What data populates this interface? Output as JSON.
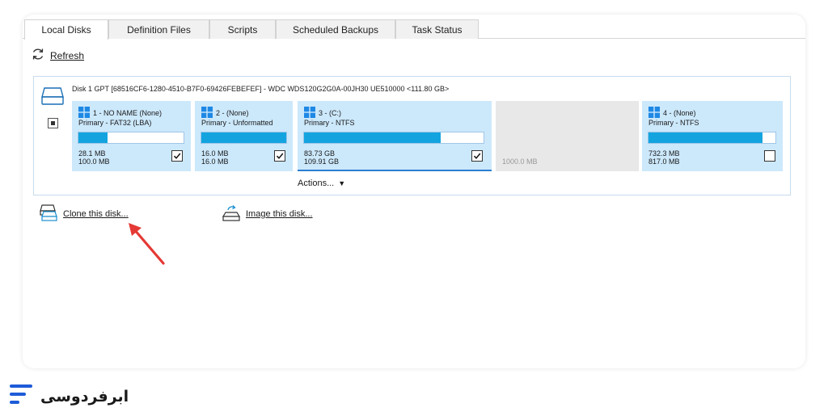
{
  "tabs": [
    {
      "label": "Local Disks"
    },
    {
      "label": "Definition Files"
    },
    {
      "label": "Scripts"
    },
    {
      "label": "Scheduled Backups"
    },
    {
      "label": "Task Status"
    }
  ],
  "toolbar": {
    "refresh_label": "Refresh",
    "icon": "refresh-icon"
  },
  "disk": {
    "title": "Disk 1 GPT [68516CF6-1280-4510-B7F0-69426FEBEFEF] - WDC WDS120G2G0A-00JH30 UE510000  <111.80 GB>",
    "icon": "hard-drive-icon",
    "partitions": [
      {
        "header": "1 - NO NAME (None)",
        "type": "Primary - FAT32 (LBA)",
        "used": "28.1 MB",
        "total": "100.0 MB",
        "fill": 0.28,
        "checked": true
      },
      {
        "header": "2 - (None)",
        "type": "Primary - Unformatted",
        "used": "16.0 MB",
        "total": "16.0 MB",
        "fill": 1.0,
        "checked": true
      },
      {
        "header": "3 - (C:)",
        "type": "Primary - NTFS",
        "used": "83.73 GB",
        "total": "109.91 GB",
        "fill": 0.76,
        "checked": true
      },
      {
        "header": "4 - (None)",
        "type": "Primary - NTFS",
        "used": "732.3 MB",
        "total": "817.0 MB",
        "fill": 0.9,
        "checked": false
      }
    ],
    "unallocated": "1000.0 MB",
    "actions_label": "Actions...",
    "accent": "#13a4e0",
    "partition_bg": "#cce8fb"
  },
  "links": {
    "clone": "Clone this disk...",
    "image": "Image this disk..."
  },
  "brand": {
    "name": "ابرفردوسی",
    "accent": "#1e5bd8"
  }
}
